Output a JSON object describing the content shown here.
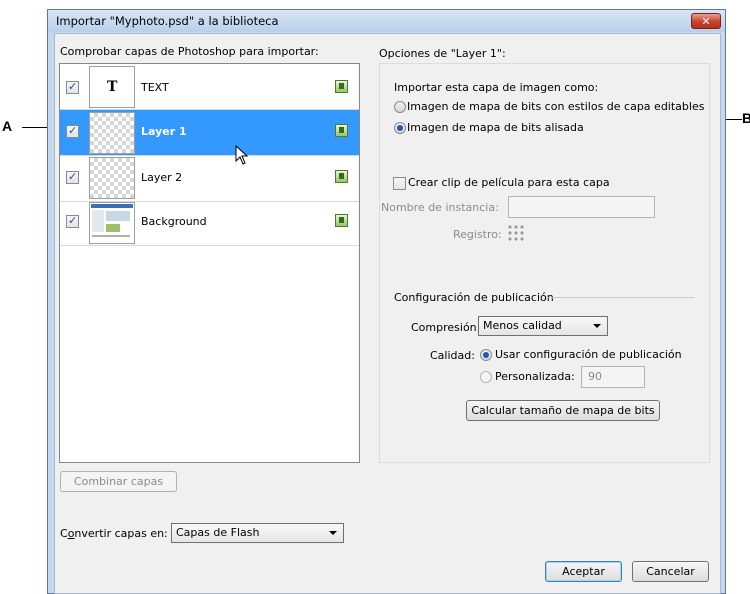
{
  "callouts": {
    "left": "A",
    "right": "B"
  },
  "dialog": {
    "title": "Importar \"Myphoto.psd\" a la biblioteca",
    "close_glyph": "✕"
  },
  "left_panel": {
    "heading": "Comprobar capas de Photoshop para importar:",
    "layers": [
      {
        "name": "TEXT",
        "checked": true,
        "selected": false,
        "thumb_text": "T"
      },
      {
        "name": "Layer 1",
        "checked": true,
        "selected": true
      },
      {
        "name": "Layer 2",
        "checked": true,
        "selected": false
      },
      {
        "name": "Background",
        "checked": true,
        "selected": false
      }
    ],
    "merge_button": "Combinar capas",
    "convert_label": "Convertir capas en:",
    "convert_value": "Capas de Flash"
  },
  "right_panel": {
    "heading": "Opciones de \"Layer 1\":",
    "import_as_label": "Importar esta capa de imagen como:",
    "option_editable": "Imagen de mapa de bits con estilos de capa editables",
    "option_flattened": "Imagen de mapa de bits alisada",
    "movie_clip_label": "Crear clip de película para esta capa",
    "instance_name_label": "Nombre de instancia:",
    "registration_label": "Registro:",
    "publish_heading": "Configuración de publicación",
    "compression_label": "Compresión:",
    "compression_value": "Menos calidad",
    "quality_label": "Calidad:",
    "quality_publish": "Usar configuración de publicación",
    "quality_custom": "Personalizada:",
    "quality_custom_value": "90",
    "calc_button": "Calcular tamaño de mapa de bits"
  },
  "footer": {
    "ok": "Aceptar",
    "cancel": "Cancelar"
  }
}
